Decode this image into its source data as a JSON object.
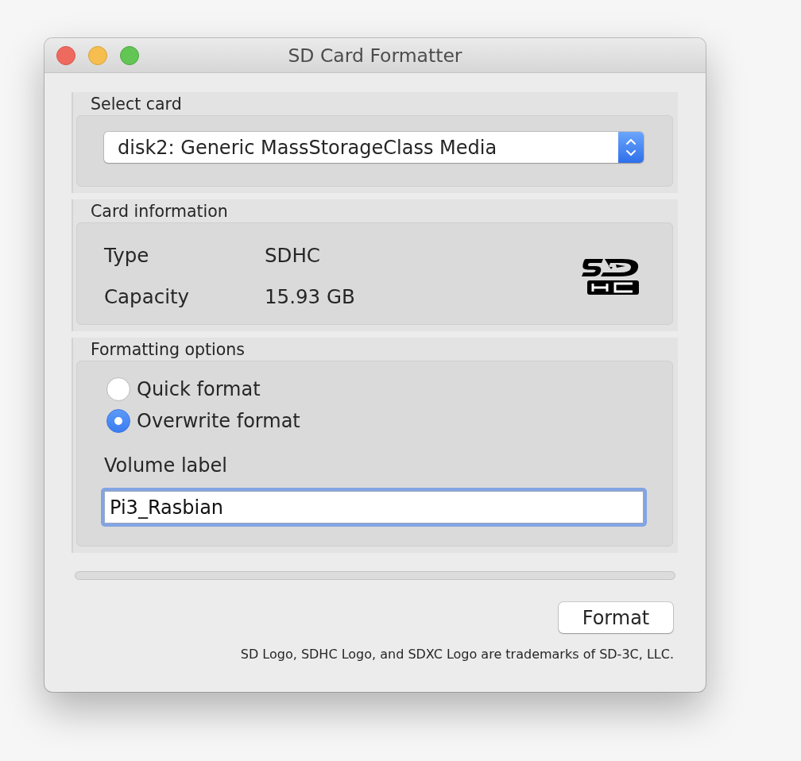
{
  "window": {
    "title": "SD Card Formatter"
  },
  "select_card": {
    "label": "Select card",
    "card_dropdown": {
      "value": "disk2: Generic MassStorageClass Media"
    }
  },
  "card_information": {
    "label": "Card information",
    "rows": [
      {
        "label": "Type",
        "value": "SDHC"
      },
      {
        "label": "Capacity",
        "value": "15.93 GB"
      }
    ]
  },
  "formatting_options": {
    "label": "Formatting options",
    "options": [
      {
        "label": "Quick format",
        "selected": false
      },
      {
        "label": "Overwrite format",
        "selected": true
      }
    ],
    "volume_label": {
      "label": "Volume label",
      "value": "Pi3_Rasbian",
      "focused": true
    }
  },
  "progress": {
    "level": 0
  },
  "buttons": [
    {
      "label": "Format"
    }
  ],
  "footer": "SD Logo, SDHC Logo, and SDXC Logo are trademarks of SD-3C, LLC."
}
